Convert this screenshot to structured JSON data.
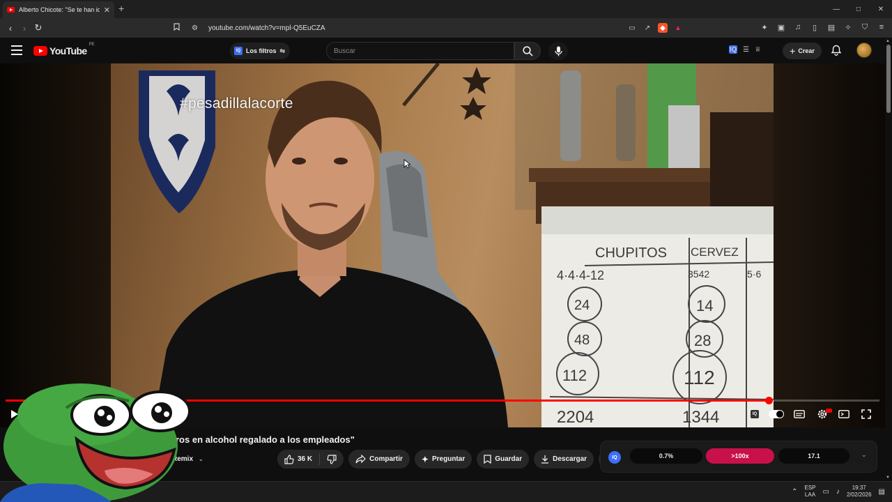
{
  "browser": {
    "tab_title": "Alberto Chicote: \"Se te han ido",
    "url": "youtube.com/watch?v=mpl-Q5EuCZA",
    "new_tab": "+",
    "tab_close": "✕",
    "win_minimize": "—",
    "win_maximize": "□",
    "win_close": "✕"
  },
  "masthead": {
    "logo_text": "YouTube",
    "country_code": "PE",
    "filters_label": "Los filtros",
    "iq_badge": "IQ",
    "search_placeholder": "Buscar",
    "create_label": "Crear"
  },
  "video": {
    "overlay_hashtag": "#pesadillalacorte",
    "progress_fraction": 0.873,
    "board_text": [
      "CHUPITOS",
      "CERVEZ",
      "4·4·4-12",
      "3542",
      "5·6",
      "24",
      "14",
      "48",
      "28",
      "112",
      "112",
      "2204",
      "1344"
    ]
  },
  "below": {
    "title": "ros en alcohol regalado a los empleados\"",
    "remix_label": "Remix",
    "like_count": "36 K",
    "share_label": "Compartir",
    "ask_label": "Preguntar",
    "save_label": "Guardar",
    "download_label": "Descargar"
  },
  "iq_panel": {
    "logo": "IQ",
    "stat_1": "0.7%",
    "stat_2": ">100x",
    "stat_3": "17.1"
  },
  "taskbar": {
    "lang_1": "ESP",
    "lang_2": "LAA",
    "time": "19:37",
    "date": "2/02/2026"
  },
  "colors": {
    "youtube_red": "#ff0000",
    "progress_red": "#ff0000",
    "iq_blue": "#3d6ff8",
    "iq_highlight": "#c8104a"
  }
}
